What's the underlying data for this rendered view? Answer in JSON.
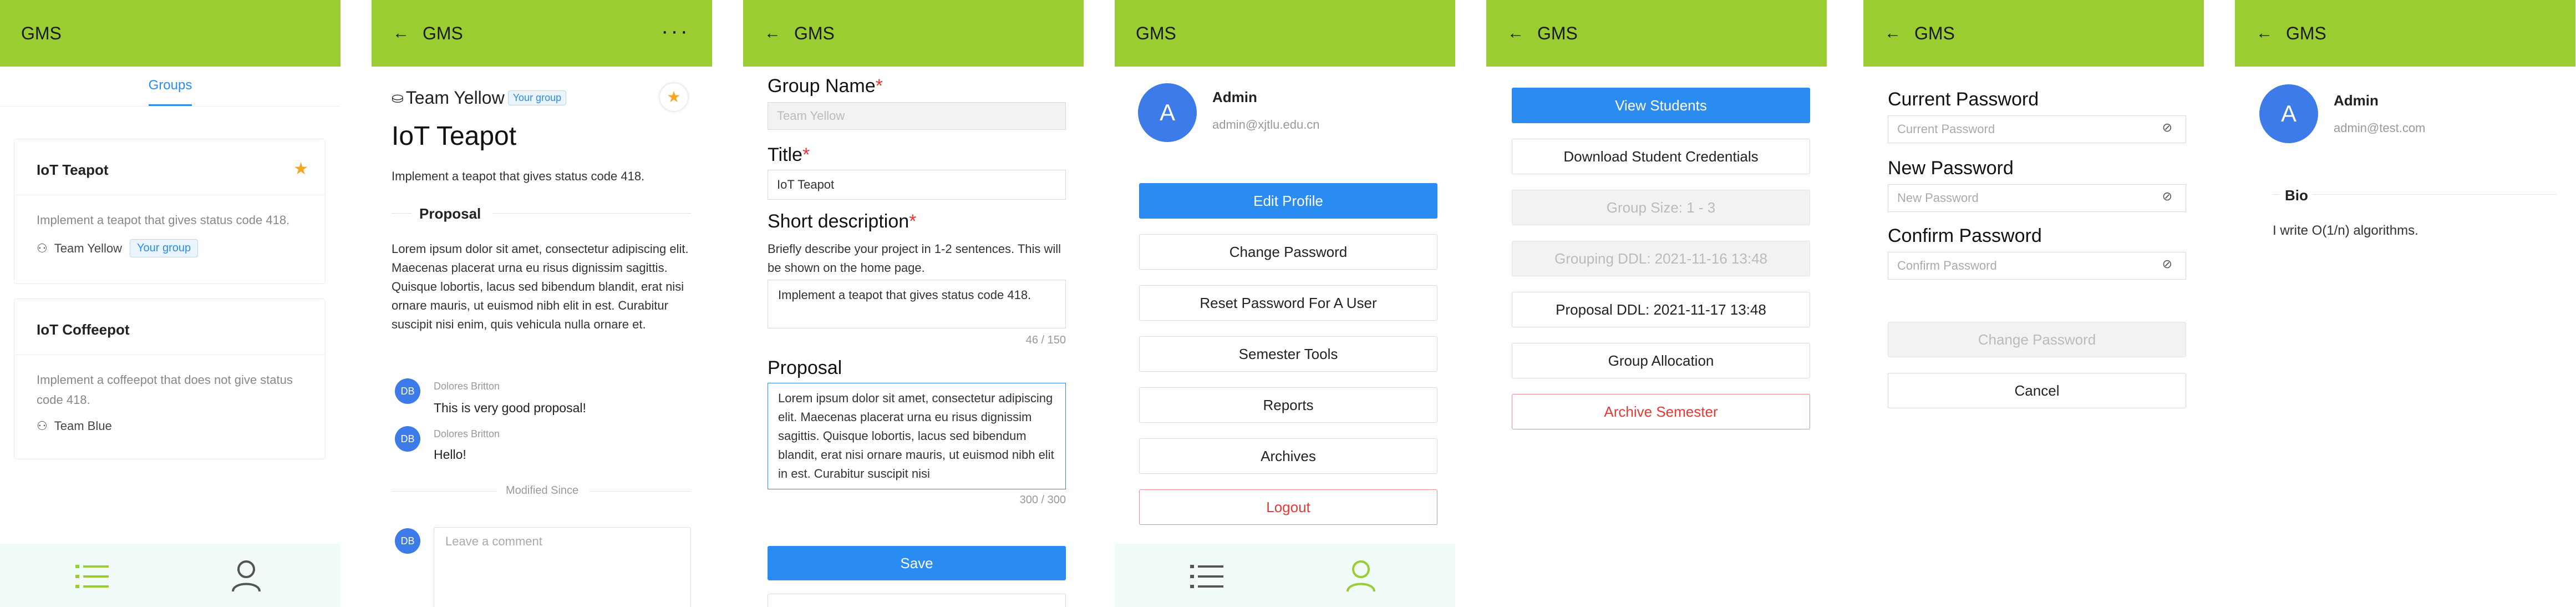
{
  "app_title": "GMS",
  "screen1": {
    "tab": "Groups",
    "cards": [
      {
        "title": "IoT Teapot",
        "desc": "Implement a teapot that gives status code 418.",
        "team": "Team Yellow",
        "badge": "Your group"
      },
      {
        "title": "IoT Coffeepot",
        "desc": "Implement a coffeepot that does not give status code 418.",
        "team": "Team Blue"
      }
    ]
  },
  "screen2": {
    "team": "Team Yellow",
    "badge": "Your group",
    "title": "IoT Teapot",
    "desc": "Implement a teapot that gives status code 418.",
    "section": "Proposal",
    "proposal": "Lorem ipsum dolor sit amet, consectetur adipiscing elit. Maecenas placerat urna eu risus dignissim sagittis. Quisque lobortis, lacus sed bibendum blandit, erat nisi ornare mauris, ut euismod nibh elit in est. Curabitur suscipit nisi enim, quis vehicula nulla ornare et.",
    "comments": [
      {
        "initials": "DB",
        "author": "Dolores Britton",
        "text": "This is very good proposal!"
      },
      {
        "initials": "DB",
        "author": "Dolores Britton",
        "text": "Hello!"
      }
    ],
    "modified": "Modified Since",
    "me_initials": "DB",
    "comment_placeholder": "Leave a comment"
  },
  "screen3": {
    "group_name_label": "Group Name",
    "group_name_value": "Team Yellow",
    "title_label": "Title",
    "title_value": "IoT Teapot",
    "short_label": "Short description",
    "short_hint": "Briefly describe your project in 1-2 sentences. This will be shown on the home page.",
    "short_value": "Implement a teapot that gives status code 418.",
    "short_count": "46 / 150",
    "proposal_label": "Proposal",
    "proposal_value": "Lorem ipsum dolor sit amet, consectetur adipiscing elit. Maecenas placerat urna eu risus dignissim sagittis. Quisque lobortis, lacus sed bibendum blandit, erat nisi ornare mauris, ut euismod nibh elit in est. Curabitur suscipit nisi",
    "proposal_count": "300 / 300",
    "save": "Save",
    "req": "*"
  },
  "screen4": {
    "avatar": "A",
    "name": "Admin",
    "email": "admin@xjtlu.edu.cn",
    "buttons": [
      "Edit Profile",
      "Change Password",
      "Reset Password For A User",
      "Semester Tools",
      "Reports",
      "Archives",
      "Logout"
    ]
  },
  "screen5": {
    "buttons": [
      "View Students",
      "Download Student Credentials",
      "Group Size: 1 - 3",
      "Grouping DDL: 2021-11-16 13:48",
      "Proposal DDL: 2021-11-17 13:48",
      "Group Allocation",
      "Archive Semester"
    ]
  },
  "screen6": {
    "current_label": "Current Password",
    "current_placeholder": "Current Password",
    "new_label": "New Password",
    "new_placeholder": "New Password",
    "confirm_label": "Confirm Password",
    "confirm_placeholder": "Confirm Password",
    "change": "Change Password",
    "cancel": "Cancel"
  },
  "screen7": {
    "avatar": "A",
    "name": "Admin",
    "email": "admin@test.com",
    "bio_title": "Bio",
    "bio": "I write O(1/n) algorithms."
  },
  "colors": {
    "header": "#9ACD32",
    "primary": "#2a8cf0",
    "danger": "#e53935",
    "star": "#f5a623",
    "tabbar": "#f0fbfa"
  }
}
